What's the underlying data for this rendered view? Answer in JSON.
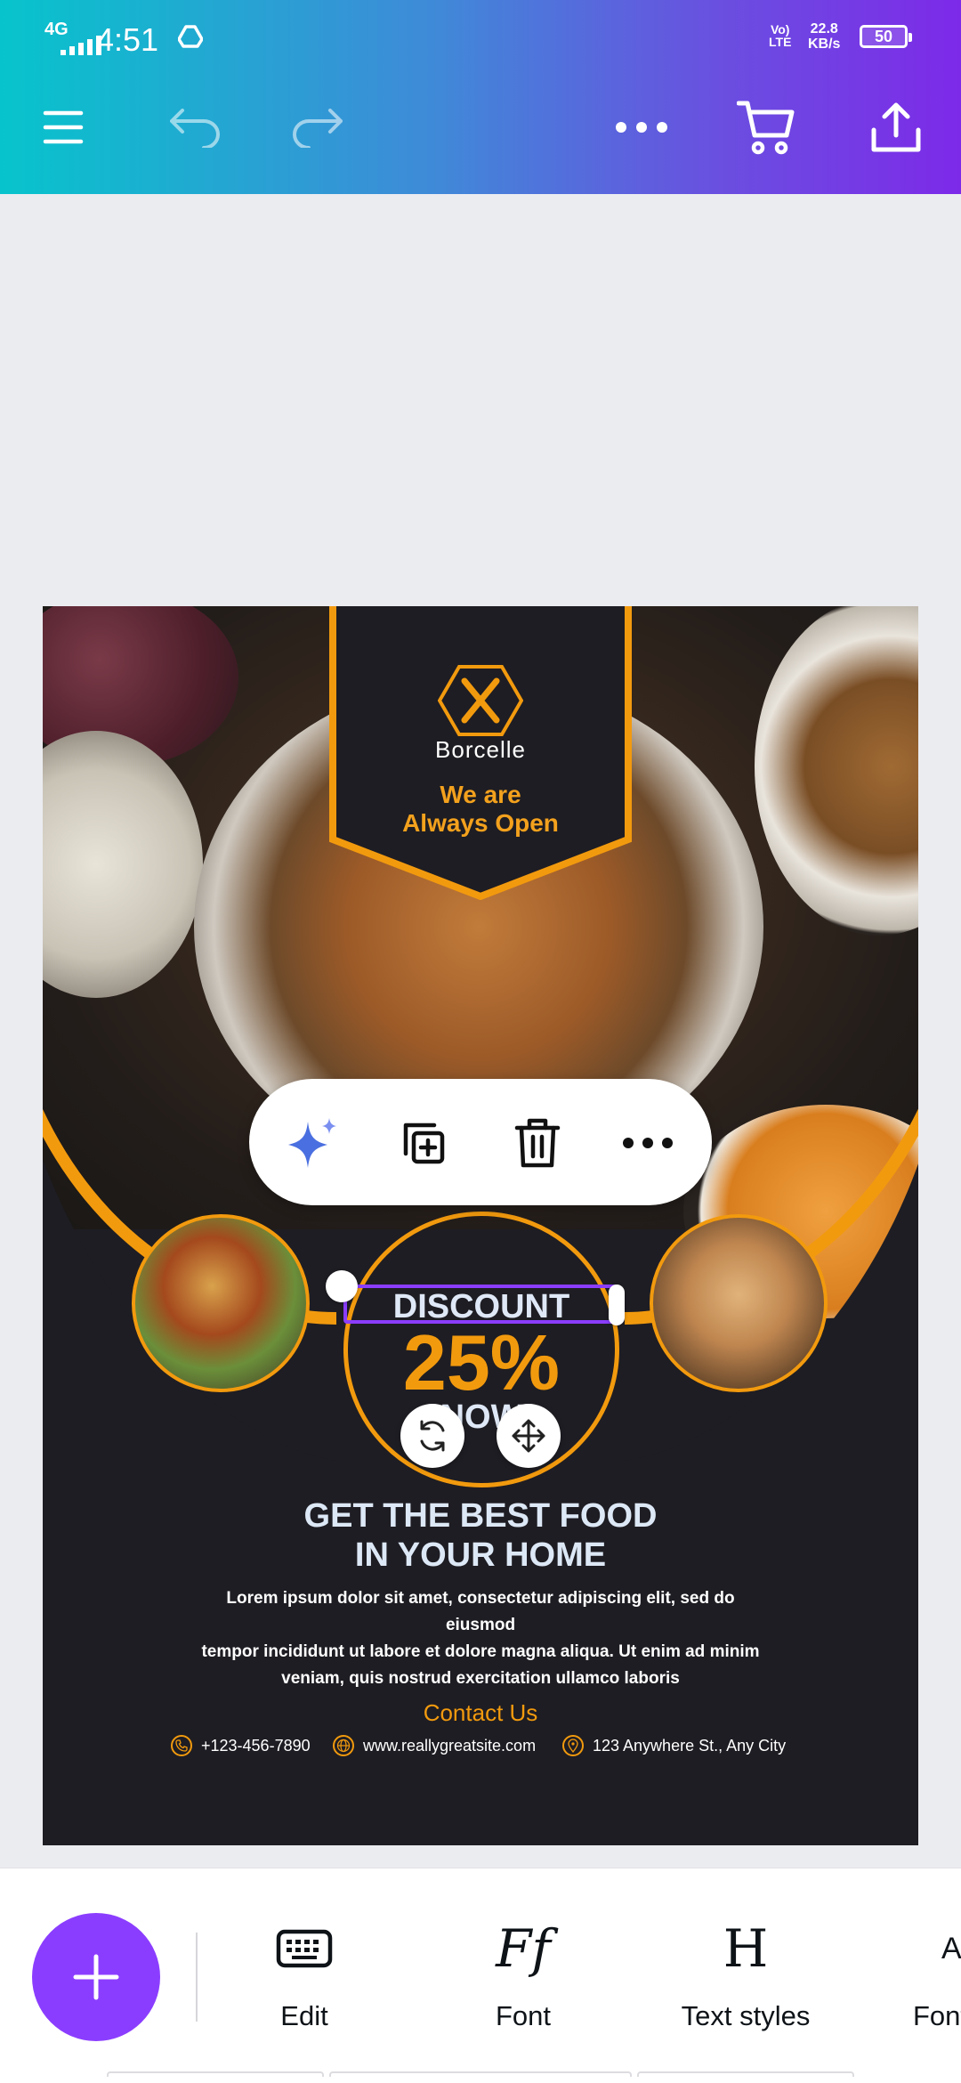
{
  "status_bar": {
    "network": "4G",
    "time": "4:51",
    "volte_top": "Vo)",
    "volte_bottom": "LTE",
    "speed_value": "22.8",
    "speed_unit": "KB/s",
    "battery": "50"
  },
  "toolbar": {
    "menu_icon": "hamburger-icon",
    "undo_icon": "undo-icon",
    "redo_icon": "redo-icon",
    "more_icon": "more-horizontal-icon",
    "cart_icon": "cart-icon",
    "share_icon": "share-upload-icon"
  },
  "design": {
    "brand": "Borcelle",
    "tagline_line1": "We are",
    "tagline_line2": "Always Open",
    "discount_label": "DISCOUNT",
    "discount_value": "25%",
    "discount_now": "NOW",
    "headline_line1": "GET THE BEST FOOD",
    "headline_line2": "IN YOUR HOME",
    "body_line1": "Lorem ipsum dolor sit amet, consectetur adipiscing elit, sed do eiusmod",
    "body_line2": "tempor incididunt ut labore et dolore magna aliqua. Ut enim ad minim",
    "body_line3": "veniam, quis nostrud exercitation ullamco laboris",
    "contact_title": "Contact Us",
    "phone": "+123-456-7890",
    "website": "www.reallygreatsite.com",
    "address": "123 Anywhere St., Any City",
    "accent_color": "#f29a0e",
    "background_color": "#1e1d23"
  },
  "context_menu": {
    "items": [
      "magic-sparkle-icon",
      "duplicate-icon",
      "delete-icon",
      "more-horizontal-icon"
    ]
  },
  "selection_controls": {
    "rotate_icon": "rotate-icon",
    "move_icon": "move-icon"
  },
  "bottom_toolbar": {
    "fab_icon": "plus-icon",
    "tools": [
      {
        "label": "Edit",
        "icon": "keyboard-icon"
      },
      {
        "label": "Font",
        "icon": "font-icon",
        "glyph": "Ff"
      },
      {
        "label": "Text styles",
        "icon": "text-styles-icon",
        "glyph": "H"
      },
      {
        "label": "Font",
        "icon": "font-size-icon",
        "glyph": "A"
      }
    ]
  },
  "theme": {
    "header_gradient_start": "#07c4cc",
    "header_gradient_end": "#7d2ae8",
    "fab_color": "#8b3dff",
    "selection_color": "#8b3dff"
  }
}
